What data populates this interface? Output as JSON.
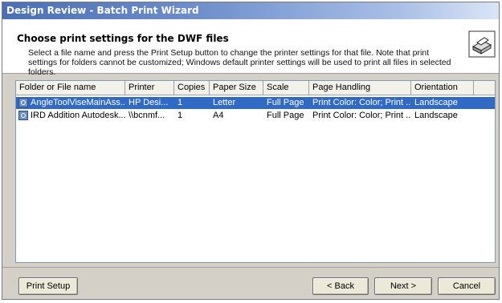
{
  "window": {
    "title": "Design Review - Batch Print Wizard"
  },
  "header": {
    "heading": "Choose print settings for the DWF files",
    "description": "Select a file name and press the Print Setup button to change the printer settings for that file. Note that print settings for folders cannot be customized; Windows default printer settings will be used to print all files in selected folders.",
    "icon": "printer-icon"
  },
  "list": {
    "columns": [
      "Folder or File name",
      "Printer",
      "Copies",
      "Paper Size",
      "Scale",
      "Page Handling",
      "Orientation"
    ],
    "rows": [
      {
        "icon": "dwf-file-icon",
        "name": "AngleToolViseMainAss...",
        "printer": "HP Desi...",
        "copies": "1",
        "paper_size": "Letter",
        "scale": "Full Page",
        "page_handling": "Print Color: Color; Print ...",
        "orientation": "Landscape",
        "selected": true
      },
      {
        "icon": "dwf-file-icon",
        "name": "IRD Addition Autodesk...",
        "printer": "\\\\bcnmf...",
        "copies": "1",
        "paper_size": "A4",
        "scale": "Full Page",
        "page_handling": "Print Color: Color; Print ...",
        "orientation": "Landscape",
        "selected": false
      }
    ]
  },
  "buttons": {
    "print_setup": "Print Setup",
    "back": "< Back",
    "next": "Next >",
    "cancel": "Cancel"
  }
}
